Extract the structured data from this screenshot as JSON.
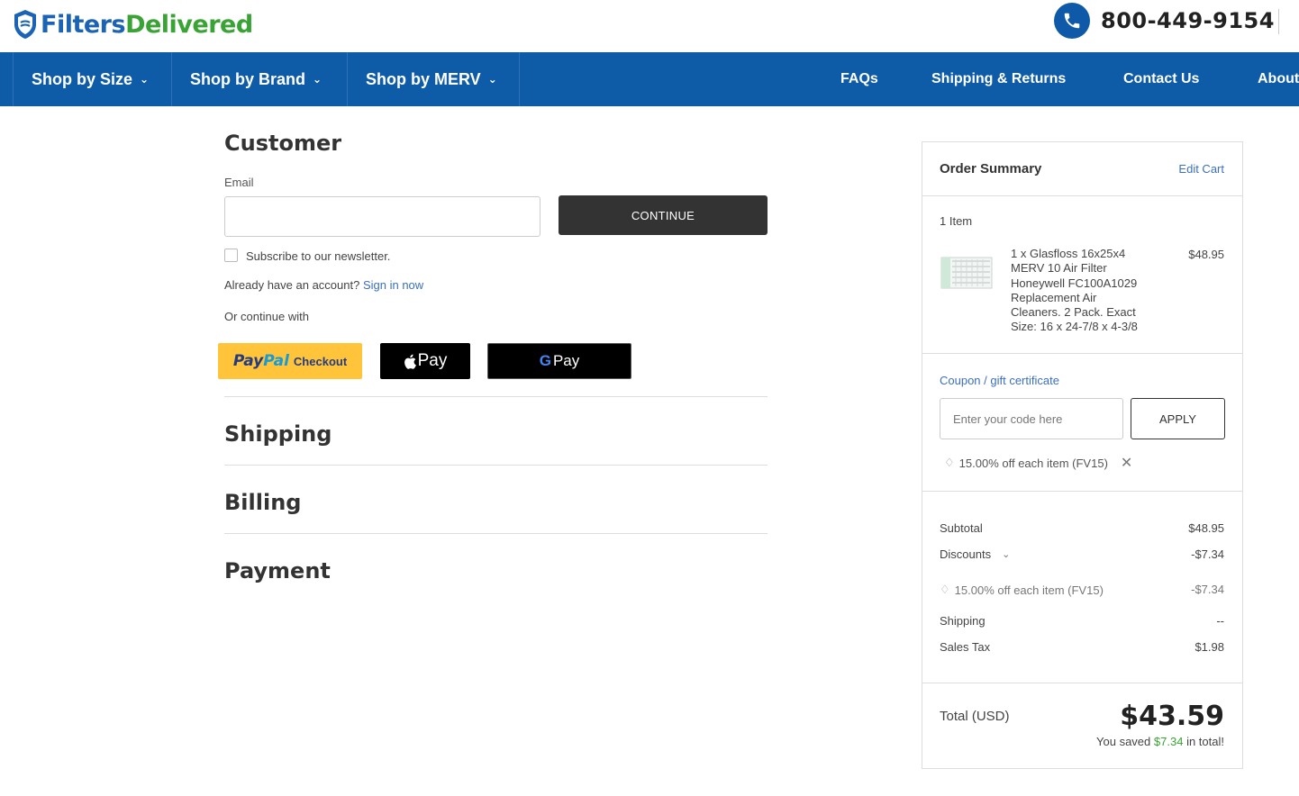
{
  "header": {
    "logo_text_a": "Filters",
    "logo_text_b": "Delivered",
    "phone": "800-449-9154",
    "colors": {
      "brand_blue": "#0e5ba8",
      "brand_green": "#3aa335"
    }
  },
  "nav": {
    "left": [
      {
        "label": "Shop by Size"
      },
      {
        "label": "Shop by Brand"
      },
      {
        "label": "Shop by MERV"
      }
    ],
    "right": [
      {
        "label": "FAQs"
      },
      {
        "label": "Shipping & Returns"
      },
      {
        "label": "Contact Us"
      },
      {
        "label": "About"
      }
    ]
  },
  "customer": {
    "title": "Customer",
    "email_label": "Email",
    "email_value": "",
    "continue_label": "CONTINUE",
    "newsletter_label": "Subscribe to our newsletter.",
    "account_prompt": "Already have an account?",
    "sign_in_link": "Sign in now",
    "or_continue": "Or continue with",
    "paypal_a": "Pay",
    "paypal_b": "Pal",
    "paypal_c": "Checkout",
    "applepay": "Pay",
    "gpay": "Pay"
  },
  "steps": {
    "shipping": "Shipping",
    "billing": "Billing",
    "payment": "Payment"
  },
  "summary": {
    "title": "Order Summary",
    "edit_cart": "Edit Cart",
    "item_count": "1 Item",
    "item_lines": [
      "1 x Glasfloss 16x25x4",
      "MERV 10 Air Filter",
      "Honeywell FC100A1029",
      "Replacement Air",
      "Cleaners. 2 Pack. Exact",
      "Size: 16 x 24-7/8 x 4-3/8"
    ],
    "item_price": "$48.95",
    "coupon_link": "Coupon / gift certificate",
    "coupon_placeholder": "Enter your code here",
    "apply_label": "APPLY",
    "applied_coupon": "15.00% off each item (FV15)",
    "subtotal_label": "Subtotal",
    "subtotal_value": "$48.95",
    "discounts_label": "Discounts",
    "discounts_value": "-$7.34",
    "discount_detail_label": "15.00% off each item (FV15)",
    "discount_detail_value": "-$7.34",
    "shipping_label": "Shipping",
    "shipping_value": "--",
    "tax_label": "Sales Tax",
    "tax_value": "$1.98",
    "total_label": "Total (USD)",
    "total_value": "$43.59",
    "saved_prefix": "You saved",
    "saved_amount": "$7.34",
    "saved_suffix": "in total!"
  }
}
